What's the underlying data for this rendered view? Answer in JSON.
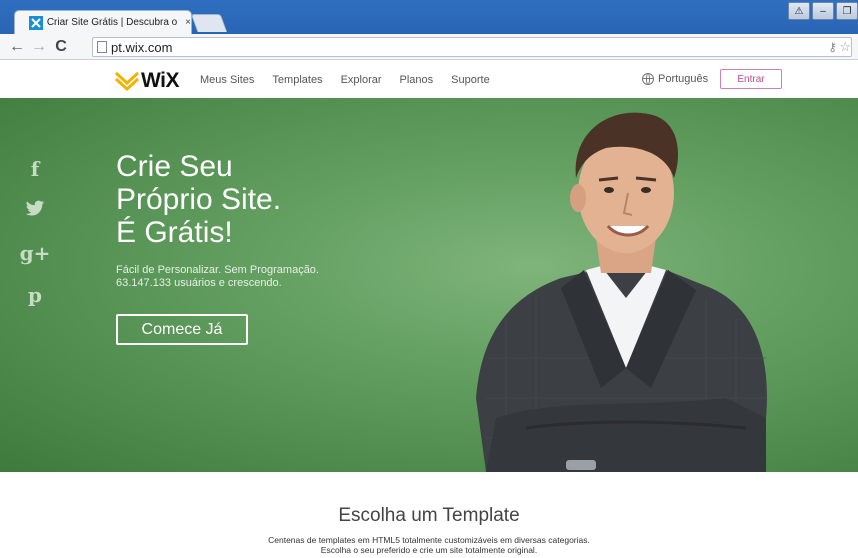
{
  "browser": {
    "tab_title": "Criar Site Grátis | Descubra o",
    "tab_close": "×",
    "url": "pt.wix.com",
    "window_buttons": [
      "⚠",
      "–",
      "❐"
    ]
  },
  "site": {
    "logo_text": "WiX",
    "nav": [
      "Meus Sites",
      "Templates",
      "Explorar",
      "Planos",
      "Suporte"
    ],
    "language": "Português",
    "login_label": "Entrar"
  },
  "hero": {
    "social": [
      "f",
      "🐦",
      "g+",
      "p"
    ],
    "headline": [
      "Crie Seu",
      "Próprio Site.",
      "É Grátis!"
    ],
    "sub_1": "Fácil de Personalizar. Sem Programação.",
    "sub_2": "63.147.133 usuários e crescendo.",
    "cta_label": "Comece Já"
  },
  "templates": {
    "title": "Escolha um Template",
    "desc_1": "Centenas de templates em HTML5 totalmente customizáveis em diversas categorias.",
    "desc_2": "Escolha o seu preferido e crie um site totalmente original."
  },
  "colors": {
    "hero_green": "#5e9b5c",
    "accent_pink": "#c04a94"
  }
}
